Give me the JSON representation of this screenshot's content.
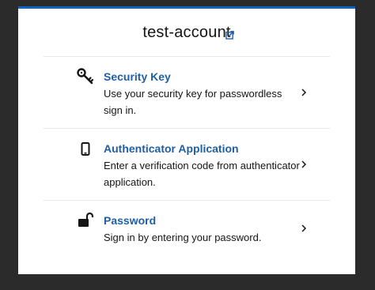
{
  "header": {
    "account_name": "test-account"
  },
  "options": [
    {
      "title": "Security Key",
      "description": "Use your security key for passwordless sign in.",
      "icon": "key-icon"
    },
    {
      "title": "Authenticator Application",
      "description": "Enter a verification code from authenticator application.",
      "icon": "mobile-phone-icon"
    },
    {
      "title": "Password",
      "description": "Sign in by entering your password.",
      "icon": "unlock-icon"
    }
  ],
  "colors": {
    "accent": "#0b66c3",
    "link": "#1f5fa6",
    "background": "#2b2b2b"
  }
}
